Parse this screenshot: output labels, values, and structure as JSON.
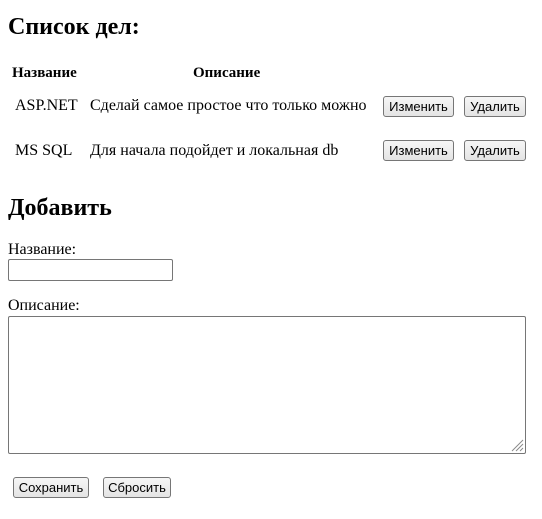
{
  "list": {
    "heading": "Список дел:",
    "columns": {
      "name": "Название",
      "description": "Описание"
    },
    "rows": [
      {
        "name": "ASP.NET",
        "description": "Сделай самое простое что только можно",
        "edit_label": "Изменить",
        "delete_label": "Удалить"
      },
      {
        "name": "MS SQL",
        "description": "Для начала подойдет и локальная db",
        "edit_label": "Изменить",
        "delete_label": "Удалить"
      }
    ]
  },
  "add_form": {
    "heading": "Добавить",
    "name_label": "Название:",
    "name_value": "",
    "description_label": "Описание:",
    "description_value": "",
    "save_label": "Сохранить",
    "reset_label": "Сбросить"
  },
  "icons": {
    "textarea_resize": "resize-grip-icon"
  }
}
